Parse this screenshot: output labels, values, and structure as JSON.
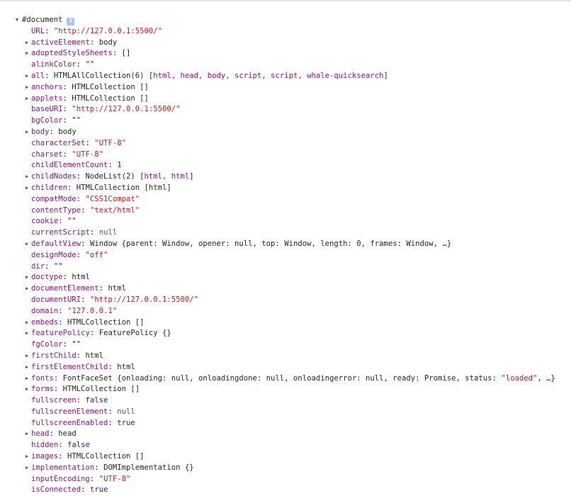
{
  "root": {
    "label": "#document",
    "info_icon": "i",
    "toggle_glyph": "▼"
  },
  "expand_glyph": "▶",
  "rows": [
    {
      "key": "URL",
      "parts": [
        {
          "t": "\"http://127.0.0.1:5500/\"",
          "c": "str"
        }
      ]
    },
    {
      "key": "activeElement",
      "expandable": true,
      "parts": [
        {
          "t": "body",
          "c": "plain"
        }
      ]
    },
    {
      "key": "adoptedStyleSheets",
      "expandable": true,
      "parts": [
        {
          "t": "[]",
          "c": "plain"
        }
      ]
    },
    {
      "key": "alinkColor",
      "parts": [
        {
          "t": "\"\"",
          "c": "plain"
        }
      ]
    },
    {
      "key": "all",
      "expandable": true,
      "parts": [
        {
          "t": "HTMLAllCollection(6) [",
          "c": "plain"
        },
        {
          "t": "html, head, body, script, script, whale-quicksearch",
          "c": "key"
        },
        {
          "t": "]",
          "c": "plain"
        }
      ]
    },
    {
      "key": "anchors",
      "expandable": true,
      "parts": [
        {
          "t": "HTMLCollection []",
          "c": "plain"
        }
      ]
    },
    {
      "key": "applets",
      "expandable": true,
      "parts": [
        {
          "t": "HTMLCollection []",
          "c": "plain"
        }
      ]
    },
    {
      "key": "baseURI",
      "parts": [
        {
          "t": "\"http://127.0.0.1:5500/\"",
          "c": "str"
        }
      ]
    },
    {
      "key": "bgColor",
      "parts": [
        {
          "t": "\"\"",
          "c": "plain"
        }
      ]
    },
    {
      "key": "body",
      "expandable": true,
      "parts": [
        {
          "t": "body",
          "c": "plain"
        }
      ]
    },
    {
      "key": "characterSet",
      "parts": [
        {
          "t": "\"UTF-8\"",
          "c": "str"
        }
      ]
    },
    {
      "key": "charset",
      "parts": [
        {
          "t": "\"UTF-8\"",
          "c": "str"
        }
      ]
    },
    {
      "key": "childElementCount",
      "parts": [
        {
          "t": "1",
          "c": "num"
        }
      ]
    },
    {
      "key": "childNodes",
      "expandable": true,
      "parts": [
        {
          "t": "NodeList(2) [",
          "c": "plain"
        },
        {
          "t": "html, html",
          "c": "key"
        },
        {
          "t": "]",
          "c": "plain"
        }
      ]
    },
    {
      "key": "children",
      "expandable": true,
      "parts": [
        {
          "t": "HTMLCollection [html]",
          "c": "plain"
        }
      ]
    },
    {
      "key": "compatMode",
      "parts": [
        {
          "t": "\"CSS1Compat\"",
          "c": "str"
        }
      ]
    },
    {
      "key": "contentType",
      "parts": [
        {
          "t": "\"text/html\"",
          "c": "str"
        }
      ]
    },
    {
      "key": "cookie",
      "parts": [
        {
          "t": "\"\"",
          "c": "plain"
        }
      ]
    },
    {
      "key": "currentScript",
      "parts": [
        {
          "t": "null",
          "c": "null"
        }
      ]
    },
    {
      "key": "defaultView",
      "expandable": true,
      "parts": [
        {
          "t": "Window {parent: Window, opener: null, top: Window, length: ",
          "c": "plain"
        },
        {
          "t": "0",
          "c": "num"
        },
        {
          "t": ", frames: Window, …}",
          "c": "plain"
        }
      ]
    },
    {
      "key": "designMode",
      "parts": [
        {
          "t": "\"off\"",
          "c": "str"
        }
      ]
    },
    {
      "key": "dir",
      "parts": [
        {
          "t": "\"\"",
          "c": "plain"
        }
      ]
    },
    {
      "key": "doctype",
      "expandable": true,
      "parts": [
        {
          "t": "html",
          "c": "plain"
        }
      ]
    },
    {
      "key": "documentElement",
      "expandable": true,
      "parts": [
        {
          "t": "html",
          "c": "plain"
        }
      ]
    },
    {
      "key": "documentURI",
      "parts": [
        {
          "t": "\"http://127.0.0.1:5500/\"",
          "c": "str"
        }
      ]
    },
    {
      "key": "domain",
      "parts": [
        {
          "t": "\"127.0.0.1\"",
          "c": "str"
        }
      ]
    },
    {
      "key": "embeds",
      "expandable": true,
      "parts": [
        {
          "t": "HTMLCollection []",
          "c": "plain"
        }
      ]
    },
    {
      "key": "featurePolicy",
      "expandable": true,
      "parts": [
        {
          "t": "FeaturePolicy {}",
          "c": "plain"
        }
      ]
    },
    {
      "key": "fgColor",
      "parts": [
        {
          "t": "\"\"",
          "c": "plain"
        }
      ]
    },
    {
      "key": "firstChild",
      "expandable": true,
      "parts": [
        {
          "t": "html",
          "c": "plain"
        }
      ]
    },
    {
      "key": "firstElementChild",
      "expandable": true,
      "parts": [
        {
          "t": "html",
          "c": "plain"
        }
      ]
    },
    {
      "key": "fonts",
      "expandable": true,
      "parts": [
        {
          "t": "FontFaceSet {onloading: null, onloadingdone: null, onloadingerror: null, ready: Promise, status: ",
          "c": "plain"
        },
        {
          "t": "\"loaded\"",
          "c": "str"
        },
        {
          "t": ", …}",
          "c": "plain"
        }
      ]
    },
    {
      "key": "forms",
      "expandable": true,
      "parts": [
        {
          "t": "HTMLCollection []",
          "c": "plain"
        }
      ]
    },
    {
      "key": "fullscreen",
      "parts": [
        {
          "t": "false",
          "c": "bool"
        }
      ]
    },
    {
      "key": "fullscreenElement",
      "parts": [
        {
          "t": "null",
          "c": "null"
        }
      ]
    },
    {
      "key": "fullscreenEnabled",
      "parts": [
        {
          "t": "true",
          "c": "bool"
        }
      ]
    },
    {
      "key": "head",
      "expandable": true,
      "parts": [
        {
          "t": "head",
          "c": "plain"
        }
      ]
    },
    {
      "key": "hidden",
      "parts": [
        {
          "t": "false",
          "c": "bool"
        }
      ]
    },
    {
      "key": "images",
      "expandable": true,
      "parts": [
        {
          "t": "HTMLCollection []",
          "c": "plain"
        }
      ]
    },
    {
      "key": "implementation",
      "expandable": true,
      "parts": [
        {
          "t": "DOMImplementation {}",
          "c": "plain"
        }
      ]
    },
    {
      "key": "inputEncoding",
      "parts": [
        {
          "t": "\"UTF-8\"",
          "c": "str"
        }
      ]
    },
    {
      "key": "isConnected",
      "parts": [
        {
          "t": "true",
          "c": "bool"
        }
      ]
    }
  ],
  "colors": {
    "key": "#881280",
    "string": "#c41a16",
    "number": "#1a1aa6",
    "plain": "#222222",
    "null": "#555555"
  }
}
